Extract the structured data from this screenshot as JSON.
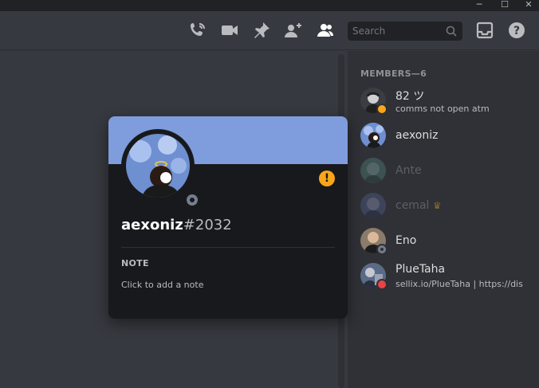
{
  "window": {
    "minimize": "─",
    "maximize": "☐",
    "close": "✕"
  },
  "toolbar": {
    "icons": [
      "threads-call-icon",
      "video-camera-icon",
      "pin-icon",
      "add-member-icon",
      "members-icon",
      "inbox-icon",
      "help-icon"
    ],
    "search_placeholder": "Search",
    "help_glyph": "?"
  },
  "members": {
    "header": "MEMBERS—6",
    "list": [
      {
        "name": "82 ツ",
        "sub": "comms not open atm",
        "status": "idle",
        "status_color": "#faa61a",
        "avatar_color": "#3a3d42",
        "offline": false
      },
      {
        "name": "aexoniz",
        "sub": "",
        "status": "none",
        "status_color": "",
        "avatar_color": "#6e8fd0",
        "offline": false
      },
      {
        "name": "Ante",
        "sub": "",
        "status": "none",
        "status_color": "",
        "avatar_color": "#4e7a74",
        "offline": true
      },
      {
        "name": "cemal",
        "sub": "",
        "status": "none",
        "status_color": "",
        "avatar_color": "#4f5b87",
        "offline": true,
        "crown": "♛"
      },
      {
        "name": "Eno",
        "sub": "",
        "status": "offline",
        "status_color": "#747f8d",
        "avatar_color": "#8c7b6a",
        "offline": false
      },
      {
        "name": "PlueTaha",
        "sub": "sellix.io/PlueTaha | https://dis",
        "status": "dnd",
        "status_color": "#ed4245",
        "avatar_color": "#5a6b88",
        "offline": false
      }
    ]
  },
  "profile": {
    "banner_color": "#7f9ddc",
    "username": "aexoniz",
    "discriminator": "#2032",
    "warning_glyph": "!",
    "note_label": "NOTE",
    "note_placeholder": "Click to add a note"
  }
}
